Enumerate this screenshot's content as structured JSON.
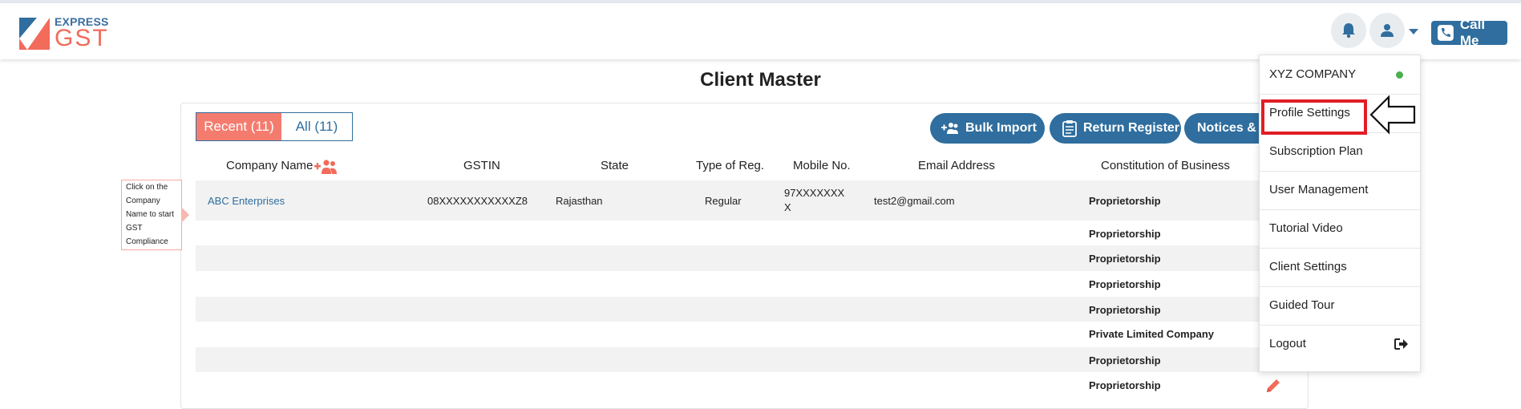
{
  "brand": {
    "line1": "EXPRESS",
    "line2": "GST",
    "accent": "#f26b5b",
    "primary": "#2f6e9e"
  },
  "header": {
    "call_me": "Call Me",
    "icons": [
      "bell-icon",
      "user-icon",
      "caret-down-icon",
      "phone-icon"
    ]
  },
  "page": {
    "title": "Client Master"
  },
  "tabs": [
    {
      "label": "Recent (11)",
      "active": true
    },
    {
      "label": "All (11)",
      "active": false
    }
  ],
  "actions": [
    {
      "label": "Bulk Import",
      "icon": "add-users-icon"
    },
    {
      "label": "Return Register",
      "icon": "clipboard-icon"
    },
    {
      "label": "Notices & C",
      "icon": ""
    }
  ],
  "table": {
    "columns": [
      "Company Name",
      "GSTIN",
      "State",
      "Type of Reg.",
      "Mobile No.",
      "Email Address",
      "Constitution of Business"
    ],
    "rows": [
      {
        "company": "ABC Enterprises",
        "gstin": "08XXXXXXXXXXXZ8",
        "state": "Rajasthan",
        "type": "Regular",
        "mobile1": "97XXXXXXX",
        "mobile2": "X",
        "email": "test2@gmail.com",
        "constitution": "Proprietorship"
      },
      {
        "constitution": "Proprietorship"
      },
      {
        "constitution": "Proprietorship"
      },
      {
        "constitution": "Proprietorship"
      },
      {
        "constitution": "Proprietorship"
      },
      {
        "constitution": "Private Limited Company"
      },
      {
        "constitution": "Proprietorship"
      },
      {
        "constitution": "Proprietorship"
      }
    ]
  },
  "tooltip": {
    "lines": [
      "Click on the",
      "Company",
      "Name to start",
      "GST",
      "Compliance"
    ]
  },
  "dropdown": {
    "company": "XYZ COMPANY",
    "status_color": "#4caf50",
    "items": [
      "Profile Settings",
      "Subscription Plan",
      "User Management",
      "Tutorial Video",
      "Client Settings",
      "Guided Tour",
      "Logout"
    ]
  }
}
